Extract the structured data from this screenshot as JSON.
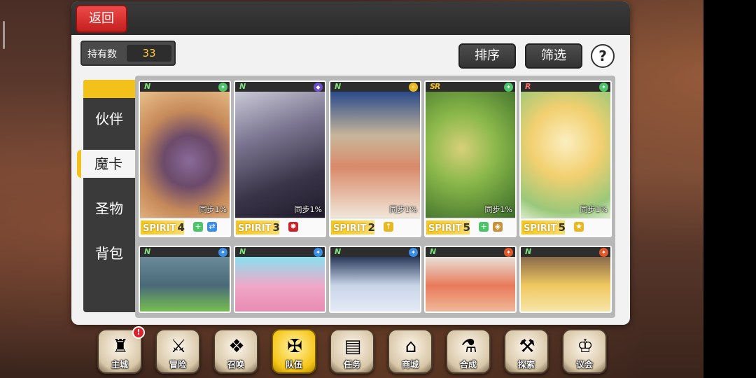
{
  "header": {
    "back_label": "返回"
  },
  "holdings": {
    "label": "持有数",
    "count": "33"
  },
  "toolbar": {
    "sort_label": "排序",
    "filter_label": "筛选",
    "help_label": "?"
  },
  "tabs": [
    {
      "label": "伙伴",
      "active": false
    },
    {
      "label": "魔卡",
      "active": true
    },
    {
      "label": "圣物",
      "active": false
    },
    {
      "label": "背包",
      "active": false
    }
  ],
  "cards_row1": [
    {
      "rarity": "N",
      "element": "wind",
      "sync": "同步1%",
      "spirit_label": "SPIRIT",
      "spirit_value": "4",
      "skills": [
        "buff",
        "debuff"
      ]
    },
    {
      "rarity": "N",
      "element": "dark",
      "sync": "同步1%",
      "spirit_label": "SPIRIT",
      "spirit_value": "3",
      "skills": [
        "attack"
      ]
    },
    {
      "rarity": "N",
      "element": "light",
      "sync": "同步1%",
      "spirit_label": "SPIRIT",
      "spirit_value": "2",
      "skills": [
        "up"
      ]
    },
    {
      "rarity": "SR",
      "element": "wind",
      "sync": "同步1%",
      "spirit_label": "SPIRIT",
      "spirit_value": "5",
      "skills": [
        "buff",
        "shield"
      ]
    },
    {
      "rarity": "R",
      "element": "wind",
      "sync": "同步1%",
      "spirit_label": "SPIRIT",
      "spirit_value": "5",
      "skills": [
        "up-star"
      ]
    }
  ],
  "cards_row2": [
    {
      "rarity": "N",
      "element": "water"
    },
    {
      "rarity": "N",
      "element": "water"
    },
    {
      "rarity": "N",
      "element": "water"
    },
    {
      "rarity": "N",
      "element": "fire"
    },
    {
      "rarity": "N",
      "element": "fire"
    }
  ],
  "nav": [
    {
      "label": "主城",
      "icon": "castle-icon",
      "badge": "!"
    },
    {
      "label": "冒险",
      "icon": "swords-icon"
    },
    {
      "label": "召唤",
      "icon": "summon-card-icon"
    },
    {
      "label": "队伍",
      "icon": "winged-emblem-icon",
      "active": true
    },
    {
      "label": "任务",
      "icon": "quest-book-icon"
    },
    {
      "label": "商城",
      "icon": "shop-icon"
    },
    {
      "label": "合成",
      "icon": "potion-icon"
    },
    {
      "label": "探索",
      "icon": "pickaxe-icon"
    },
    {
      "label": "议会",
      "icon": "council-crest-icon"
    }
  ],
  "colors": {
    "accent": "#f2c21a",
    "back_button": "#e03a3a",
    "wind": "#4ec46a",
    "dark": "#6a4fc8",
    "light": "#e8b820",
    "water": "#3a8ee6",
    "fire": "#e0582a"
  }
}
